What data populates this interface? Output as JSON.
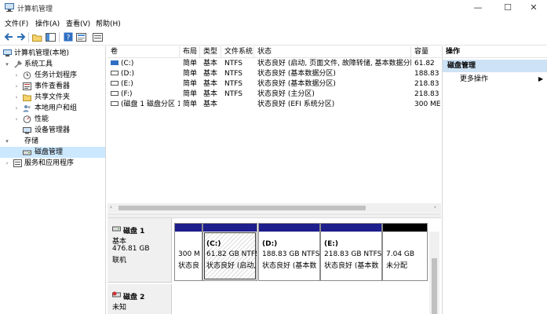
{
  "window": {
    "title": "计算机管理",
    "minimize_glyph": "—",
    "maximize_glyph": "☐",
    "close_glyph": "✕"
  },
  "menu": [
    "文件(F)",
    "操作(A)",
    "查看(V)",
    "帮助(H)"
  ],
  "tree": {
    "root": "计算机管理(本地)",
    "system_tools": "系统工具",
    "task_scheduler": "任务计划程序",
    "event_viewer": "事件查看器",
    "shared_folders": "共享文件夹",
    "local_users": "本地用户和组",
    "performance": "性能",
    "device_manager": "设备管理器",
    "storage": "存储",
    "disk_management": "磁盘管理",
    "services": "服务和应用程序"
  },
  "volume_table": {
    "headers": [
      "卷",
      "布局",
      "类型",
      "文件系统",
      "状态",
      "容量"
    ],
    "rows": [
      [
        "(C:)",
        "简单",
        "基本",
        "NTFS",
        "状态良好 (启动, 页面文件, 故障转储, 基本数据分区)",
        "61.82"
      ],
      [
        "(D:)",
        "简单",
        "基本",
        "NTFS",
        "状态良好 (基本数据分区)",
        "188.83"
      ],
      [
        "(E:)",
        "简单",
        "基本",
        "NTFS",
        "状态良好 (基本数据分区)",
        "218.83"
      ],
      [
        "(F:)",
        "简单",
        "基本",
        "NTFS",
        "状态良好 (主分区)",
        "218.83"
      ],
      [
        "(磁盘 1 磁盘分区 1)",
        "简单",
        "基本",
        "",
        "状态良好 (EFI 系统分区)",
        "300 ME"
      ]
    ]
  },
  "disk1": {
    "name": "磁盘 1",
    "type": "基本",
    "size": "476.81 GB",
    "status": "联机",
    "partitions": [
      {
        "title": "",
        "line1": "300 M",
        "line2": "状态良"
      },
      {
        "title": "(C:)",
        "line1": "61.82 GB NTFS",
        "line2": "状态良好 (启动,"
      },
      {
        "title": "(D:)",
        "line1": "188.83 GB NTFS",
        "line2": "状态良好 (基本数"
      },
      {
        "title": "(E:)",
        "line1": "218.83 GB NTFS",
        "line2": "状态良好 (基本数"
      },
      {
        "title": "",
        "line1": "7.04 GB",
        "line2": "未分配"
      }
    ]
  },
  "disk2": {
    "name": "磁盘 2",
    "status": "未知"
  },
  "actions": {
    "header": "操作",
    "selected": "磁盘管理",
    "more": "更多操作",
    "more_arrow": "▶"
  }
}
